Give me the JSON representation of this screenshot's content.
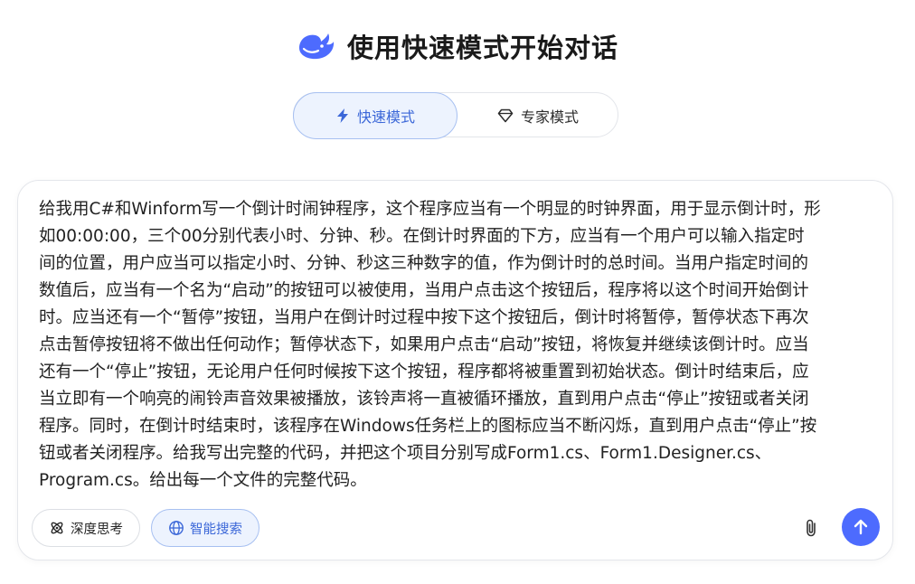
{
  "header": {
    "logo_icon": "whale-logo-icon",
    "title": "使用快速模式开始对话"
  },
  "mode_toggle": {
    "fast": {
      "label": "快速模式",
      "icon": "lightning-icon",
      "selected": true
    },
    "expert": {
      "label": "专家模式",
      "icon": "diamond-icon",
      "selected": false
    }
  },
  "composer": {
    "prompt_lines": [
      "给我用C#和Winform写一个倒计时闹钟程序，这个程序应当有一个明显的时钟界面，用于显示倒计时，形",
      "如00:00:00，三个00分别代表小时、分钟、秒。在倒计时界面的下方，应当有一个用户可以输入指定时",
      "间的位置，用户应当可以指定小时、分钟、秒这三种数字的值，作为倒计时的总时间。当用户指定时间的",
      "数值后，应当有一个名为“启动”的按钮可以被使用，当用户点击这个按钮后，程序将以这个时间开始倒计",
      "时。应当还有一个“暂停”按钮，当用户在倒计时过程中按下这个按钮后，倒计时将暂停，暂停状态下再次",
      "点击暂停按钮将不做出任何动作；暂停状态下，如果用户点击“启动”按钮，将恢复并继续该倒计时。应当",
      "还有一个“停止”按钮，无论用户任何时候按下这个按钮，程序都将被重置到初始状态。倒计时结束后，应",
      "当立即有一个响亮的闹铃声音效果被播放，该铃声将一直被循环播放，直到用户点击“停止”按钮或者关闭",
      "程序。同时，在倒计时结束时，该程序在Windows任务栏上的图标应当不断闪烁，直到用户点击“停止”按",
      "钮或者关闭程序。给我写出完整的代码，并把这个项目分别写成Form1.cs、Form1.Designer.cs、",
      "Program.cs。给出每一个文件的完整代码。"
    ],
    "deep_think": {
      "label": "深度思考",
      "icon": "atom-icon",
      "active": false
    },
    "web_search": {
      "label": "智能搜索",
      "icon": "globe-icon",
      "active": true
    },
    "attach_icon": "paperclip-icon",
    "send_icon": "arrow-up-icon"
  },
  "colors": {
    "accent": "#4d6bfe",
    "accent_text": "#3b67d8",
    "accent_bg": "#edf3fe",
    "accent_border": "#a7c0f1"
  }
}
